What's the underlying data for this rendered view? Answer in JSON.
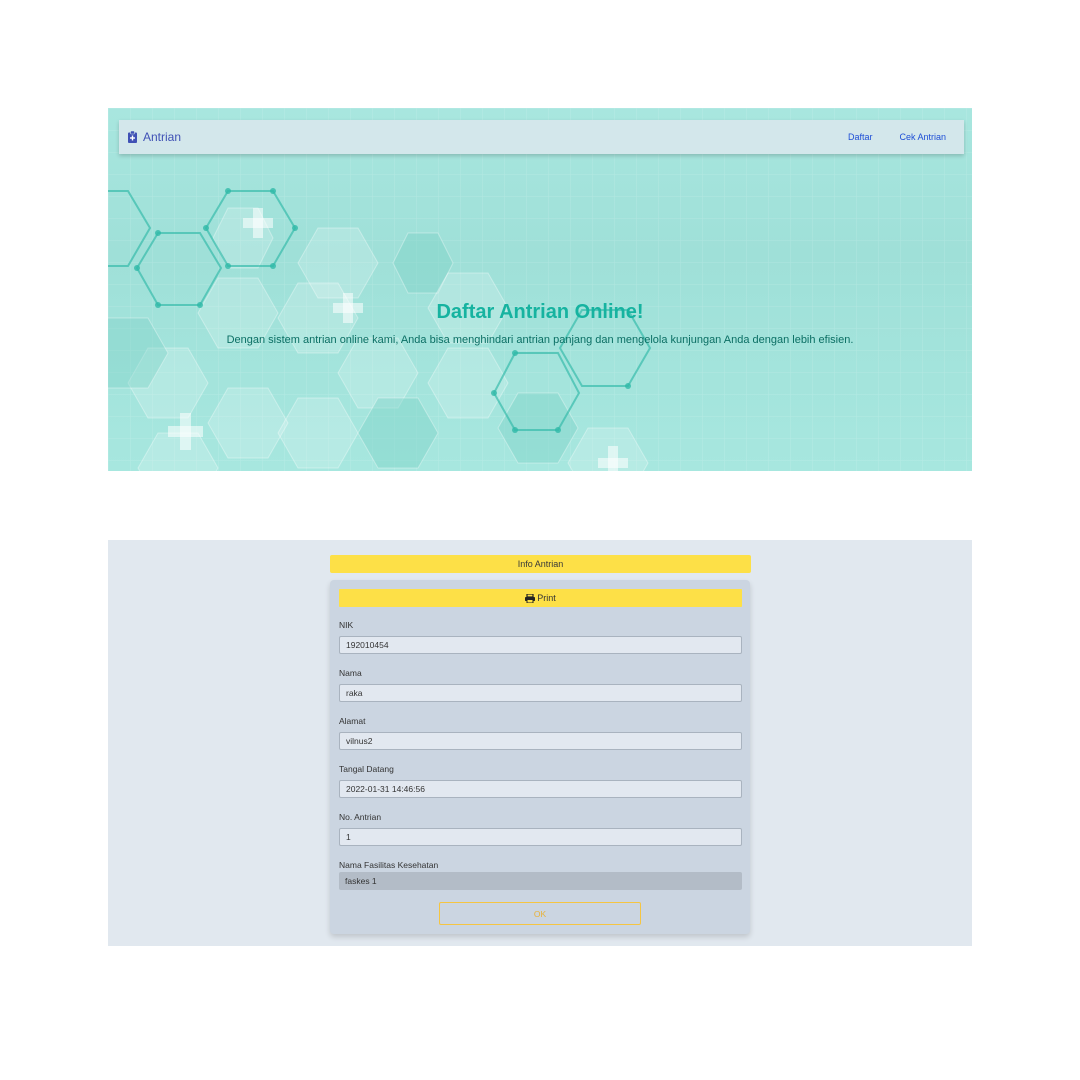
{
  "navbar": {
    "brand": "Antrian",
    "links": [
      "Daftar",
      "Cek Antrian"
    ]
  },
  "hero": {
    "title": "Daftar Antrian Online!",
    "subtitle": "Dengan sistem antrian online kami, Anda bisa menghindari antrian panjang dan mengelola kunjungan Anda dengan lebih efisien."
  },
  "info": {
    "header": "Info Antrian",
    "print_label": "Print",
    "fields": {
      "nik": {
        "label": "NIK",
        "value": "192010454"
      },
      "nama": {
        "label": "Nama",
        "value": "raka"
      },
      "alamat": {
        "label": "Alamat",
        "value": "vilnus2"
      },
      "tanggal": {
        "label": "Tangal Datang",
        "value": "2022-01-31 14:46:56"
      },
      "antrian": {
        "label": "No. Antrian",
        "value": "1"
      },
      "faskes": {
        "label": "Nama Fasilitas Kesehatan",
        "value": "faskes 1"
      }
    },
    "ok_label": "OK"
  },
  "icons": {
    "brand": "clipboard-plus-icon",
    "print": "printer-icon"
  },
  "colors": {
    "brand": "#3f51b5",
    "hero_title": "#16b3a0",
    "hero_bg": "#a8e6df",
    "accent_yellow": "#fde047",
    "nav_link": "#1e4fd6",
    "card_bg": "#cbd5e1"
  }
}
